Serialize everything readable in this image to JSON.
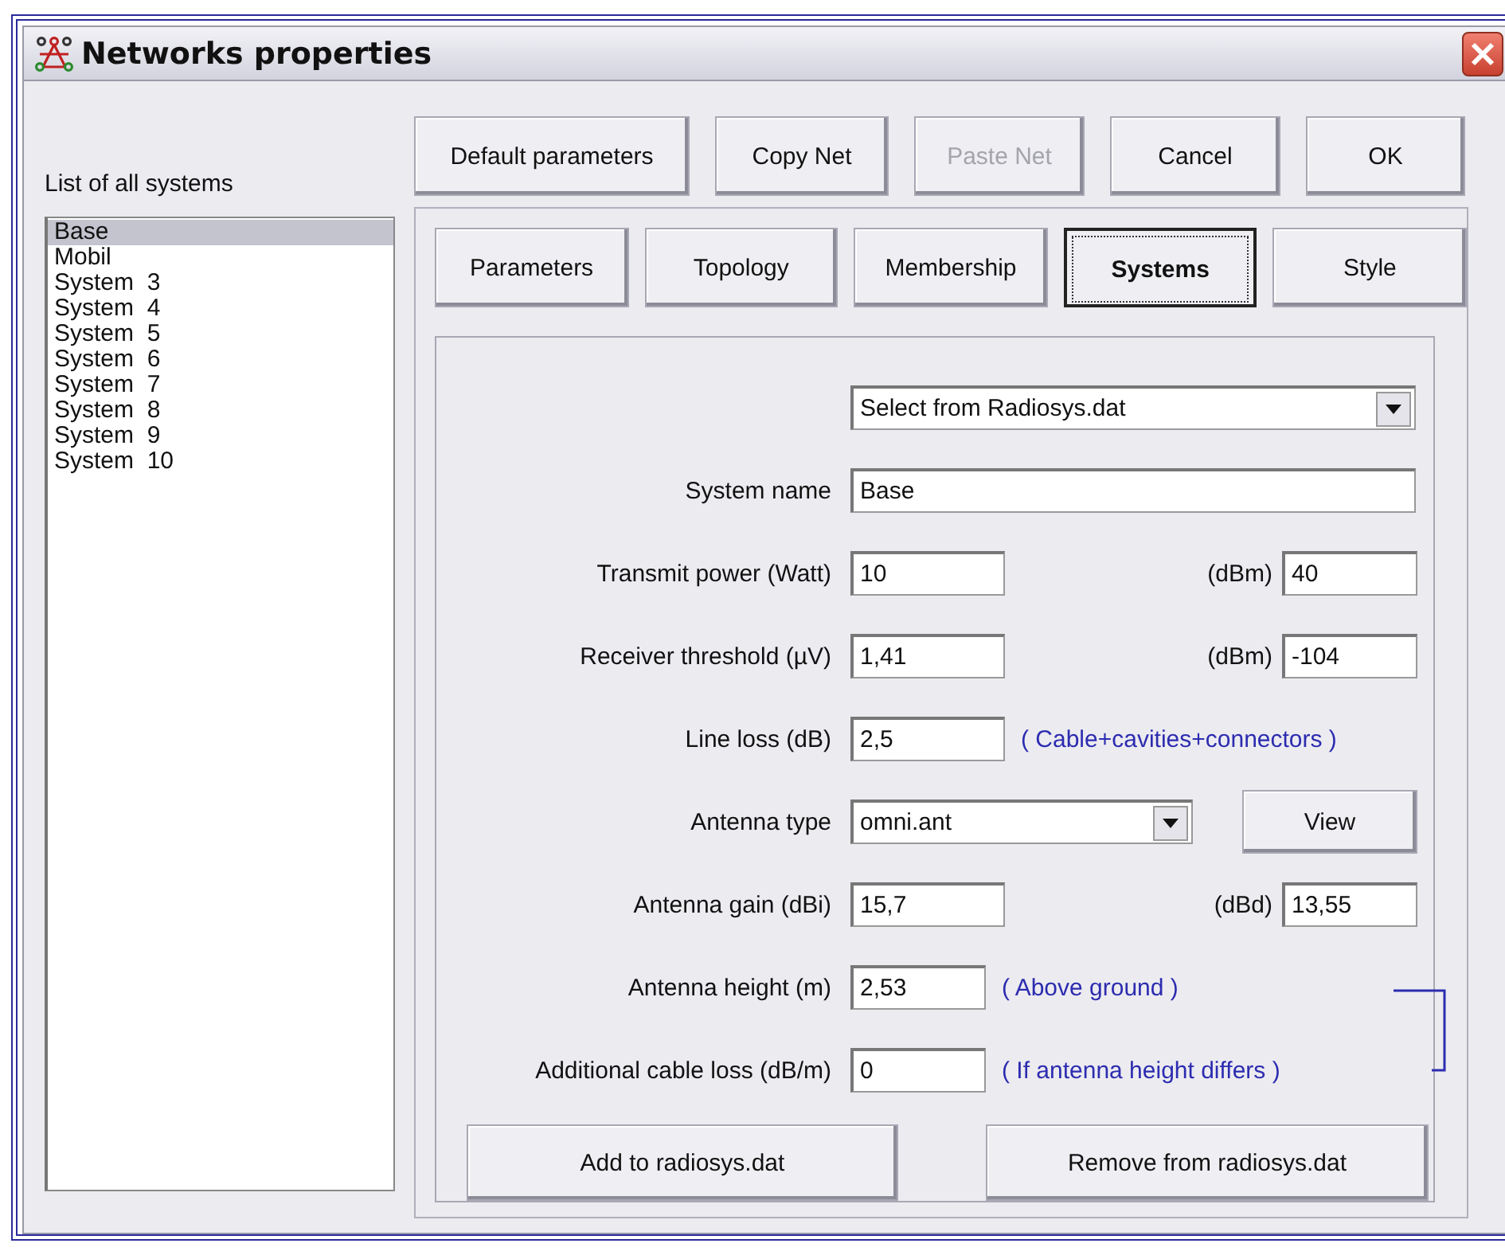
{
  "window": {
    "title": "Networks properties"
  },
  "systems_list": {
    "label": "List of all systems",
    "items": [
      {
        "text": "Base",
        "selected": true
      },
      {
        "text": "Mobil",
        "selected": false
      },
      {
        "text": "System  3",
        "selected": false
      },
      {
        "text": "System  4",
        "selected": false
      },
      {
        "text": "System  5",
        "selected": false
      },
      {
        "text": "System  6",
        "selected": false
      },
      {
        "text": "System  7",
        "selected": false
      },
      {
        "text": "System  8",
        "selected": false
      },
      {
        "text": "System  9",
        "selected": false
      },
      {
        "text": "System  10",
        "selected": false
      }
    ]
  },
  "top_buttons": [
    {
      "label": "Default parameters",
      "disabled": false
    },
    {
      "label": "Copy Net",
      "disabled": false
    },
    {
      "label": "Paste Net",
      "disabled": true
    },
    {
      "label": "Cancel",
      "disabled": false
    },
    {
      "label": "OK",
      "disabled": false
    }
  ],
  "tabs": [
    {
      "label": "Parameters",
      "selected": false
    },
    {
      "label": "Topology",
      "selected": false
    },
    {
      "label": "Membership",
      "selected": false
    },
    {
      "label": "Systems",
      "selected": true
    },
    {
      "label": "Style",
      "selected": false
    }
  ],
  "form": {
    "rows": [
      {
        "kind": "select",
        "value": "Select from Radiosys.dat"
      },
      {
        "kind": "wide",
        "label": "System name",
        "value": "Base"
      },
      {
        "kind": "pair",
        "label": "Transmit power (Watt)",
        "value": "10",
        "unit": "(dBm)",
        "value2": "40"
      },
      {
        "kind": "pair",
        "label": "Receiver threshold (µV)",
        "value": "1,41",
        "unit": "(dBm)",
        "value2": "-104"
      },
      {
        "kind": "note",
        "label": "Line loss (dB)",
        "value": "2,5",
        "note": "( Cable+cavities+connectors )",
        "linked_to_next": false
      },
      {
        "kind": "combo",
        "label": "Antenna type",
        "value": "omni.ant",
        "button": "View"
      },
      {
        "kind": "pair",
        "label": "Antenna gain (dBi)",
        "value": "15,7",
        "unit": "(dBd)",
        "value2": "13,55"
      },
      {
        "kind": "note",
        "label": "Antenna height (m)",
        "value": "2,53",
        "note": "( Above ground )",
        "linked_to_next": true
      },
      {
        "kind": "note",
        "label": "Additional cable loss (dB/m)",
        "value": "0",
        "note": "( If antenna height differs )",
        "linked_to_next": false
      }
    ],
    "buttons": [
      "Add to radiosys.dat",
      "Remove from radiosys.dat"
    ]
  }
}
